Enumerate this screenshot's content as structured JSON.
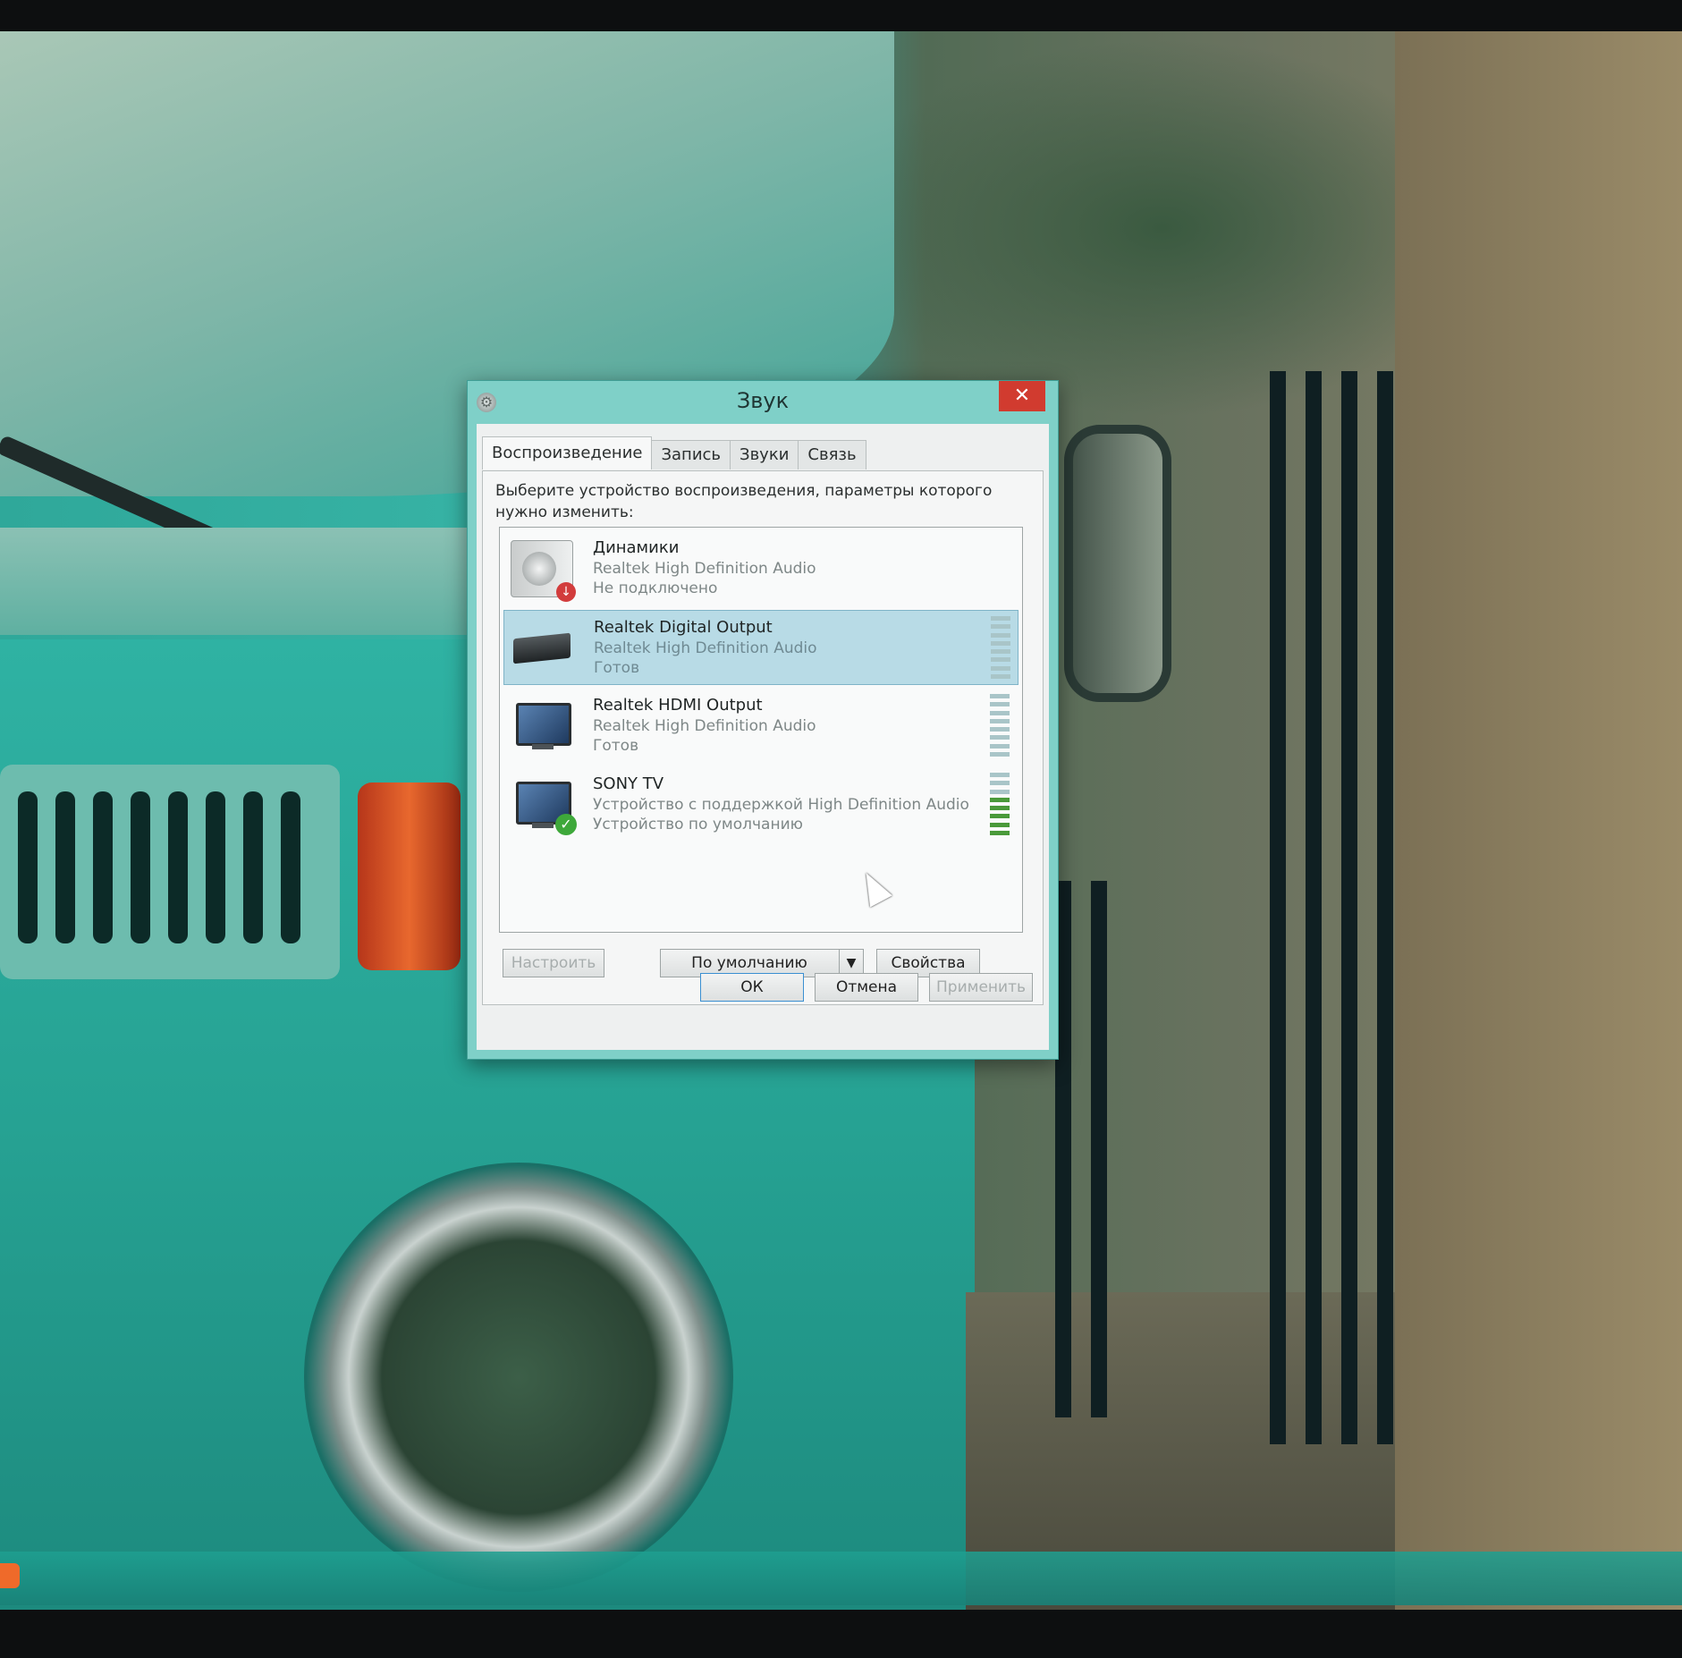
{
  "dialog": {
    "title": "Звук",
    "tabs": [
      "Воспроизведение",
      "Запись",
      "Звуки",
      "Связь"
    ],
    "active_tab": "Воспроизведение",
    "instruction": "Выберите устройство воспроизведения, параметры которого нужно изменить:",
    "devices": [
      {
        "name": "Динамики",
        "driver": "Realtek High Definition Audio",
        "status": "Не подключено",
        "icon": "speaker-icon",
        "selected": false
      },
      {
        "name": "Realtek Digital Output",
        "driver": "Realtek High Definition Audio",
        "status": "Готов",
        "icon": "digital-receiver-icon",
        "selected": true
      },
      {
        "name": "Realtek HDMI Output",
        "driver": "Realtek High Definition Audio",
        "status": "Готов",
        "icon": "monitor-icon",
        "selected": false
      },
      {
        "name": "SONY TV",
        "driver": "Устройство с поддержкой High Definition Audio",
        "status": "Устройство по умолчанию",
        "icon": "monitor-icon",
        "selected": false
      }
    ],
    "buttons": {
      "configure": "Настроить",
      "set_default": "По умолчанию",
      "properties": "Свойства",
      "ok": "ОК",
      "cancel": "Отмена",
      "apply": "Применить"
    }
  },
  "colors": {
    "window_frame": "#7fd0c8",
    "close_button": "#d13b2f",
    "selection": "#b8dbe6",
    "meter_active": "#4a9a3a"
  }
}
